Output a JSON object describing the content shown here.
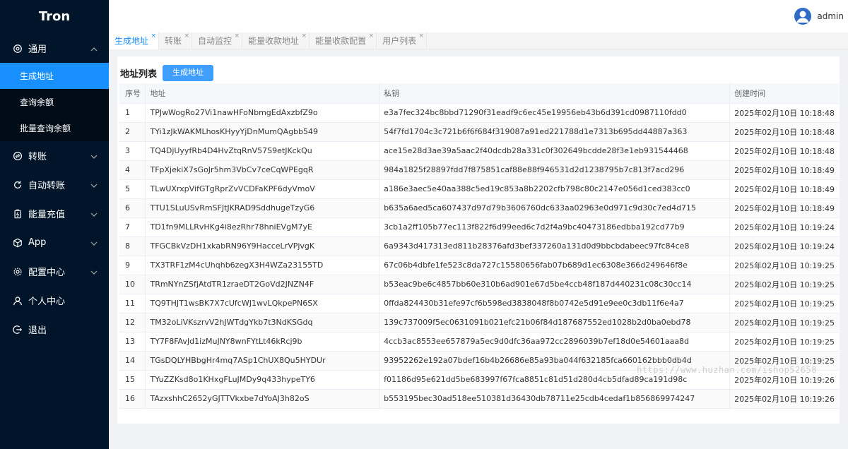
{
  "app": {
    "title": "Tron"
  },
  "user": {
    "name": "admin"
  },
  "menu": {
    "general": {
      "label": "通用",
      "items": [
        {
          "label": "生成地址"
        },
        {
          "label": "查询余额"
        },
        {
          "label": "批量查询余额"
        }
      ]
    },
    "transfer": {
      "label": "转账"
    },
    "auto_transfer": {
      "label": "自动转账"
    },
    "energy": {
      "label": "能量充值"
    },
    "app": {
      "label": "App"
    },
    "config": {
      "label": "配置中心"
    },
    "profile": {
      "label": "个人中心"
    },
    "logout": {
      "label": "退出"
    }
  },
  "tabs": [
    {
      "label": "生成地址",
      "close": "×"
    },
    {
      "label": "转账",
      "close": "×"
    },
    {
      "label": "自动监控",
      "close": "×"
    },
    {
      "label": "能量收款地址",
      "close": "×"
    },
    {
      "label": "能量收款配置",
      "close": "×"
    },
    {
      "label": "用户列表",
      "close": "×"
    }
  ],
  "page": {
    "title": "地址列表",
    "generate_button": "生成地址"
  },
  "table": {
    "columns": {
      "no": "序号",
      "address": "地址",
      "private_key": "私钥",
      "created": "创建时间"
    },
    "rows": [
      {
        "no": "1",
        "address": "TPJwWogRo27Vi1nawHFoNbmgEdAxzbfZ9o",
        "private_key": "e3a7fec324bc8bbd71290f31eadf9c6ec45e19956eb43b6d391cd0987110fdd0",
        "created": "2025年02月10日 10:18:48"
      },
      {
        "no": "2",
        "address": "TYi1zJkWAKMLhosKHyyYjDnMumQAgbb549",
        "private_key": "54f7fd1704c3c721b6f6f684f319087a91ed221788d1e7313b695dd44887a363",
        "created": "2025年02月10日 10:18:48"
      },
      {
        "no": "3",
        "address": "TQ4DjUyyfRb4D4HvZtqRnV57S9etJKckQu",
        "private_key": "ace15e28d3ae39a5aac2f40dcdb28a331c0f302649bcdde28f3e1eb931544468",
        "created": "2025年02月10日 10:18:48"
      },
      {
        "no": "4",
        "address": "TFpXjekiX7sGoJr5hm3VbCv7ceCqWPEgqR",
        "private_key": "984a1825f28897fdd7f875851caf88e88f946531d2d1238795b7c813f7acd296",
        "created": "2025年02月10日 10:18:49"
      },
      {
        "no": "5",
        "address": "TLwUXrxpVifGTgRprZvVCDFaKPF6dyVmoV",
        "private_key": "a186e3aec5e40aa388c5ed19c853a8b2202cfb798c80c2147e056d1ced383cc0",
        "created": "2025年02月10日 10:18:49"
      },
      {
        "no": "6",
        "address": "TTU1SLuUSvRmSFJtJKRAD9SddhugeTzyG6",
        "private_key": "b635a6aed5ca607437d97d79b3606760dc633aa02963e0d971c9d30c7ed4d715",
        "created": "2025年02月10日 10:18:49"
      },
      {
        "no": "7",
        "address": "TD1fn9MLLRvHKg4i8ezRhr78hniEVgM7yE",
        "private_key": "3cb1a2ff105b77ec113f822f6d99eed6c7d2f4a9bc40473186edbba192cd77b9",
        "created": "2025年02月10日 10:19:24"
      },
      {
        "no": "8",
        "address": "TFGCBkVzDH1xkabRN96Y9HacceLrVPjvgK",
        "private_key": "6a9343d417313ed811b28376afd3bef337260a131d0d9bbcbdabeec97fc84ce8",
        "created": "2025年02月10日 10:19:24"
      },
      {
        "no": "9",
        "address": "TX3TRF1zM4cUhqhb6zegX3H4WZa23155TD",
        "private_key": "67c06b4dbfe1fe523c8da727c15580656fab07b689d1ec6308e366d249646f8e",
        "created": "2025年02月10日 10:19:25"
      },
      {
        "no": "10",
        "address": "TRmNYnZSfjAtdTR1zraeDT2GoVd2JNZN4F",
        "private_key": "b53eac9be6c4857bb60e310b6ad901e67d5be4ccb48f187d440231c08c30cc14",
        "created": "2025年02月10日 10:19:25"
      },
      {
        "no": "11",
        "address": "TQ9THJT1wsBK7X7cUfcWJ1wvLQkpePN6SX",
        "private_key": "0ffda824430b31efe97cf6b598ed3838048f8b0742e5d91e9ee0c3db11f6e4a7",
        "created": "2025年02月10日 10:19:25"
      },
      {
        "no": "12",
        "address": "TM32oLiVKszrvV2hJWTdgYkb7t3NdKSGdq",
        "private_key": "139c737009f5ec0631091b021efc21b06f84d187687552ed1028b2d0ba0ebd78",
        "created": "2025年02月10日 10:19:25"
      },
      {
        "no": "13",
        "address": "TY7F8FAvJd1izMuJNY8wnFYtLt46kRcj9b",
        "private_key": "4ccb3ac8553ee657879a5ec9d0dfc36aa972cc2896039b7ef18d0e54601aaa8d",
        "created": "2025年02月10日 10:19:25"
      },
      {
        "no": "14",
        "address": "TGsDQLYHBbgHr4mq7ASp1ChUX8Qu5HYDUr",
        "private_key": "93952262e192a07bdef16b4b26686e85a93ba044f632185fca660162bbb0db4d",
        "created": "2025年02月10日 10:19:25"
      },
      {
        "no": "15",
        "address": "TYuZZKsd8o1KHxgFLuJMDy9q433hypeTY6",
        "private_key": "f01186d95e621dd5be683997f67fca8851c81d51d280d4cb5dfad89ca191d98c",
        "created": "2025年02月10日 10:19:26"
      },
      {
        "no": "16",
        "address": "TAzxshhC2652yGJTTVkxbe7dYoAJ3h82oS",
        "private_key": "b553195bec30ad518ee510381d36430db78711e25cdb4cedaf1b856869974247",
        "created": "2025年02月10日 10:19:26"
      }
    ]
  },
  "watermark": "https://www.huzhan.com/ishop52658",
  "colors": {
    "sidebar_bg": "#001529",
    "submenu_bg": "#000c17",
    "accent": "#1890ff",
    "button": "#409eff"
  },
  "icons": {
    "general": "settings-icon",
    "transfer": "transfer-icon",
    "auto_transfer": "refresh-icon",
    "energy": "battery-icon",
    "app": "cube-icon",
    "config": "gear-icon",
    "profile": "user-icon",
    "logout": "logout-icon",
    "avatar": "user-avatar-icon"
  }
}
